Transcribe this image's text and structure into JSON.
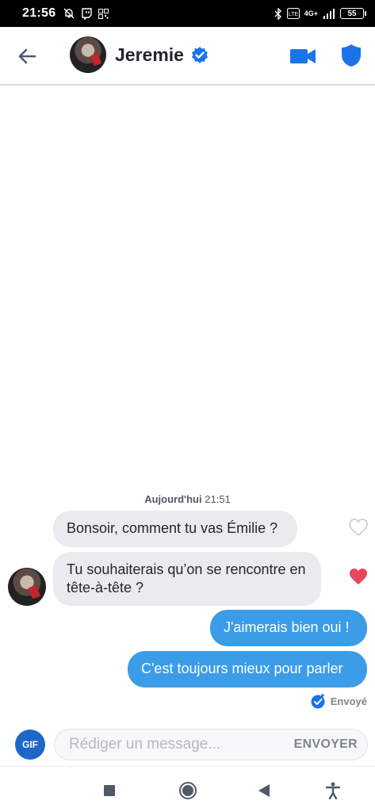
{
  "status_bar": {
    "time": "21:56",
    "battery": "55",
    "network": "4G+"
  },
  "header": {
    "contact_name": "Jeremie",
    "icons": [
      "back-arrow-icon",
      "avatar",
      "verified-badge-icon",
      "video-call-icon",
      "shield-icon"
    ],
    "accent_color": "#1a73e8"
  },
  "chat": {
    "date_label": "Aujourd'hui",
    "date_time": "21:51",
    "messages": [
      {
        "direction": "incoming",
        "text": "Bonsoir, comment tu vas Émilie ?",
        "liked": false
      },
      {
        "direction": "incoming",
        "text": "Tu souhaiterais qu’on se rencontre en tête-à-tête ?",
        "liked": true
      },
      {
        "direction": "outgoing",
        "text": "J'aimerais bien oui !"
      },
      {
        "direction": "outgoing",
        "text": "C'est toujours mieux pour parler"
      }
    ],
    "sent_status": "Envoyé"
  },
  "composer": {
    "gif_label": "GIF",
    "placeholder": "Rédiger un message...",
    "value": "",
    "send_label": "ENVOYER"
  },
  "colors": {
    "outgoing_bubble": "#3b9ce8",
    "incoming_bubble": "#e9ebee",
    "like_heart": "#e8455e",
    "gif_button": "#1d67c9"
  }
}
